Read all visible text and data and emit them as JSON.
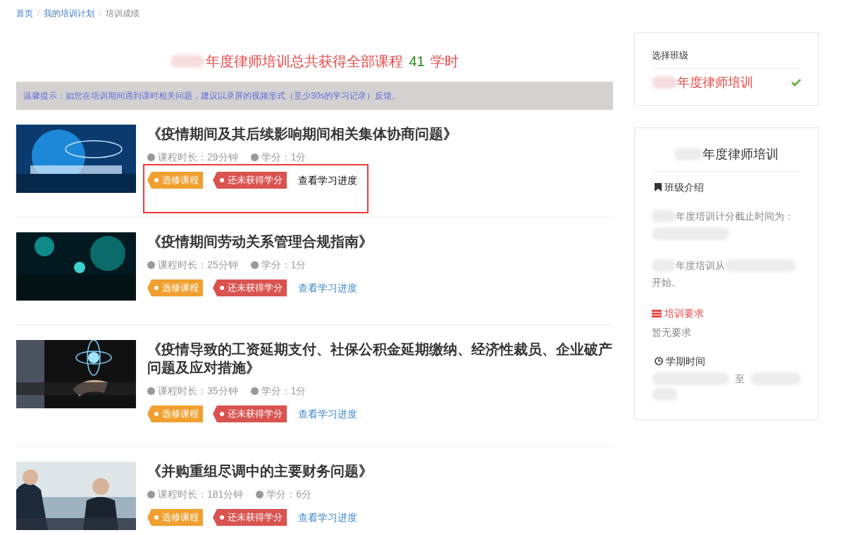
{
  "breadcrumb": [
    {
      "label": "首页",
      "current": false,
      "separator": "/"
    },
    {
      "label": "我的培训计划",
      "current": false,
      "separator": "/"
    },
    {
      "label": "培训成绩",
      "current": true
    }
  ],
  "headline": {
    "prefix": "年度律师培训总共获得全部课程",
    "hours": "41",
    "suffix": "学时"
  },
  "notice": "温馨提示：如您在培训期间遇到课时相关问题，建议以录屏的视频形式（至少30s的学习记录）反馈。",
  "courses": [
    {
      "title": "《疫情期间及其后续影响期间相关集体协商问题》",
      "duration": "课程时长：29分钟",
      "credit": "学分：1分",
      "tags": [
        {
          "label": "选修课程",
          "kind": "elective"
        },
        {
          "label": "还未获得学分",
          "kind": "no-credit"
        }
      ],
      "progress_link": "查看学习进度",
      "highlighted": true
    },
    {
      "title": "《疫情期间劳动关系管理合规指南》",
      "duration": "课程时长：25分钟",
      "credit": "学分：1分",
      "tags": [
        {
          "label": "选修课程",
          "kind": "elective"
        },
        {
          "label": "还未获得学分",
          "kind": "no-credit"
        }
      ],
      "progress_link": "查看学习进度",
      "highlighted": false
    },
    {
      "title": "《疫情导致的工资延期支付、社保公积金延期缴纳、经济性裁员、企业破产问题及应对措施》",
      "duration": "课程时长：35分钟",
      "credit": "学分：1分",
      "tags": [
        {
          "label": "选修课程",
          "kind": "elective"
        },
        {
          "label": "还未获得学分",
          "kind": "no-credit"
        }
      ],
      "progress_link": "查看学习进度",
      "highlighted": false
    },
    {
      "title": "《并购重组尽调中的主要财务问题》",
      "duration": "课程时长：181分钟",
      "credit": "学分：6分",
      "tags": [
        {
          "label": "选修课程",
          "kind": "elective"
        },
        {
          "label": "还未获得学分",
          "kind": "no-credit"
        }
      ],
      "progress_link": "查看学习进度",
      "highlighted": false
    }
  ],
  "class_select": {
    "heading": "选择班级",
    "items": [
      {
        "label": "年度律师培训",
        "selected": true
      }
    ]
  },
  "class_info": {
    "title": "年度律师培训",
    "intro_heading": "班级介绍",
    "intro_1": "年度培训计分截止时间为：",
    "intro_2a": "年度培训从",
    "intro_2b": "开始。",
    "requirement_heading": "培训要求",
    "requirement": "暂无要求",
    "term_heading": "学期时间",
    "term_sep": "至"
  }
}
